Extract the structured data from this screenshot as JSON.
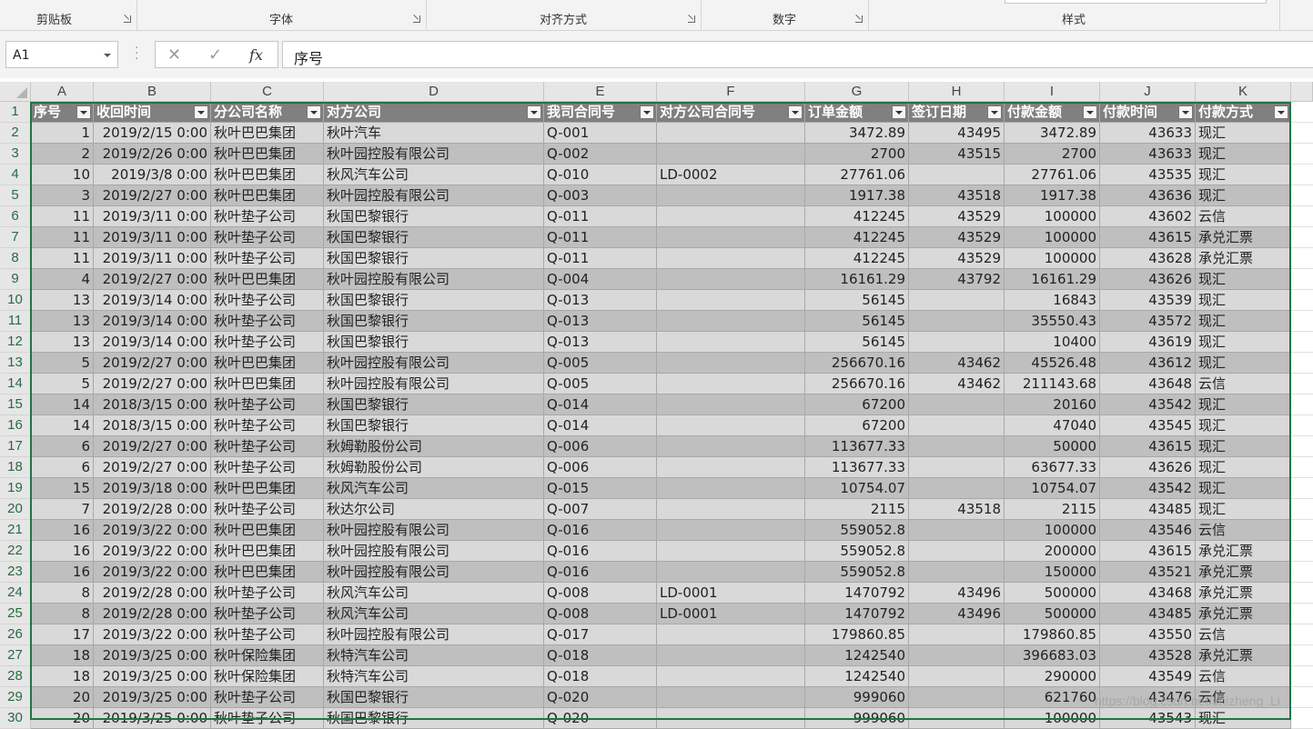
{
  "ribbon": {
    "groups": [
      {
        "label": "剪贴板",
        "launcher": true
      },
      {
        "label": "字体",
        "launcher": true
      },
      {
        "label": "对齐方式",
        "launcher": true
      },
      {
        "label": "数字",
        "launcher": true
      },
      {
        "label": "样式",
        "launcher": false
      }
    ]
  },
  "formula_bar": {
    "name_box": "A1",
    "cancel_icon": "✕",
    "enter_icon": "✓",
    "fx_label": "fx",
    "value": "序号"
  },
  "columns": [
    "A",
    "B",
    "C",
    "D",
    "E",
    "F",
    "G",
    "H",
    "I",
    "J",
    "K"
  ],
  "table": {
    "headers": [
      "序号",
      "收回时间",
      "分公司名称",
      "对方公司",
      "我司合同号",
      "对方公司合同号",
      "订单金额",
      "签订日期",
      "付款金额",
      "付款时间",
      "付款方式"
    ],
    "rows": [
      [
        "1",
        "2019/2/15 0:00",
        "秋叶巴巴集团",
        "秋叶汽车",
        "Q-001",
        "",
        "3472.89",
        "43495",
        "3472.89",
        "43633",
        "现汇"
      ],
      [
        "2",
        "2019/2/26 0:00",
        "秋叶巴巴集团",
        "秋叶园控股有限公司",
        "Q-002",
        "",
        "2700",
        "43515",
        "2700",
        "43633",
        "现汇"
      ],
      [
        "10",
        "2019/3/8 0:00",
        "秋叶巴巴集团",
        "秋风汽车公司",
        "Q-010",
        "LD-0002",
        "27761.06",
        "",
        "27761.06",
        "43535",
        "现汇"
      ],
      [
        "3",
        "2019/2/27 0:00",
        "秋叶巴巴集团",
        "秋叶园控股有限公司",
        "Q-003",
        "",
        "1917.38",
        "43518",
        "1917.38",
        "43636",
        "现汇"
      ],
      [
        "11",
        "2019/3/11 0:00",
        "秋叶垫子公司",
        "秋国巴黎银行",
        "Q-011",
        "",
        "412245",
        "43529",
        "100000",
        "43602",
        "云信"
      ],
      [
        "11",
        "2019/3/11 0:00",
        "秋叶垫子公司",
        "秋国巴黎银行",
        "Q-011",
        "",
        "412245",
        "43529",
        "100000",
        "43615",
        "承兑汇票"
      ],
      [
        "11",
        "2019/3/11 0:00",
        "秋叶垫子公司",
        "秋国巴黎银行",
        "Q-011",
        "",
        "412245",
        "43529",
        "100000",
        "43628",
        "承兑汇票"
      ],
      [
        "4",
        "2019/2/27 0:00",
        "秋叶巴巴集团",
        "秋叶园控股有限公司",
        "Q-004",
        "",
        "16161.29",
        "43792",
        "16161.29",
        "43626",
        "现汇"
      ],
      [
        "13",
        "2019/3/14 0:00",
        "秋叶垫子公司",
        "秋国巴黎银行",
        "Q-013",
        "",
        "56145",
        "",
        "16843",
        "43539",
        "现汇"
      ],
      [
        "13",
        "2019/3/14 0:00",
        "秋叶垫子公司",
        "秋国巴黎银行",
        "Q-013",
        "",
        "56145",
        "",
        "35550.43",
        "43572",
        "现汇"
      ],
      [
        "13",
        "2019/3/14 0:00",
        "秋叶垫子公司",
        "秋国巴黎银行",
        "Q-013",
        "",
        "56145",
        "",
        "10400",
        "43619",
        "现汇"
      ],
      [
        "5",
        "2019/2/27 0:00",
        "秋叶巴巴集团",
        "秋叶园控股有限公司",
        "Q-005",
        "",
        "256670.16",
        "43462",
        "45526.48",
        "43612",
        "现汇"
      ],
      [
        "5",
        "2019/2/27 0:00",
        "秋叶巴巴集团",
        "秋叶园控股有限公司",
        "Q-005",
        "",
        "256670.16",
        "43462",
        "211143.68",
        "43648",
        "云信"
      ],
      [
        "14",
        "2018/3/15 0:00",
        "秋叶垫子公司",
        "秋国巴黎银行",
        "Q-014",
        "",
        "67200",
        "",
        "20160",
        "43542",
        "现汇"
      ],
      [
        "14",
        "2018/3/15 0:00",
        "秋叶垫子公司",
        "秋国巴黎银行",
        "Q-014",
        "",
        "67200",
        "",
        "47040",
        "43545",
        "现汇"
      ],
      [
        "6",
        "2019/2/27 0:00",
        "秋叶垫子公司",
        "秋姆勒股份公司",
        "Q-006",
        "",
        "113677.33",
        "",
        "50000",
        "43615",
        "现汇"
      ],
      [
        "6",
        "2019/2/27 0:00",
        "秋叶垫子公司",
        "秋姆勒股份公司",
        "Q-006",
        "",
        "113677.33",
        "",
        "63677.33",
        "43626",
        "现汇"
      ],
      [
        "15",
        "2019/3/18 0:00",
        "秋叶巴巴集团",
        "秋风汽车公司",
        "Q-015",
        "",
        "10754.07",
        "",
        "10754.07",
        "43542",
        "现汇"
      ],
      [
        "7",
        "2019/2/28 0:00",
        "秋叶垫子公司",
        "秋达尔公司",
        "Q-007",
        "",
        "2115",
        "43518",
        "2115",
        "43485",
        "现汇"
      ],
      [
        "16",
        "2019/3/22 0:00",
        "秋叶巴巴集团",
        "秋叶园控股有限公司",
        "Q-016",
        "",
        "559052.8",
        "",
        "100000",
        "43546",
        "云信"
      ],
      [
        "16",
        "2019/3/22 0:00",
        "秋叶巴巴集团",
        "秋叶园控股有限公司",
        "Q-016",
        "",
        "559052.8",
        "",
        "200000",
        "43615",
        "承兑汇票"
      ],
      [
        "16",
        "2019/3/22 0:00",
        "秋叶巴巴集团",
        "秋叶园控股有限公司",
        "Q-016",
        "",
        "559052.8",
        "",
        "150000",
        "43521",
        "承兑汇票"
      ],
      [
        "8",
        "2019/2/28 0:00",
        "秋叶垫子公司",
        "秋风汽车公司",
        "Q-008",
        "LD-0001",
        "1470792",
        "43496",
        "500000",
        "43468",
        "承兑汇票"
      ],
      [
        "8",
        "2019/2/28 0:00",
        "秋叶垫子公司",
        "秋风汽车公司",
        "Q-008",
        "LD-0001",
        "1470792",
        "43496",
        "500000",
        "43485",
        "承兑汇票"
      ],
      [
        "17",
        "2019/3/22 0:00",
        "秋叶垫子公司",
        "秋叶园控股有限公司",
        "Q-017",
        "",
        "179860.85",
        "",
        "179860.85",
        "43550",
        "云信"
      ],
      [
        "18",
        "2019/3/25 0:00",
        "秋叶保险集团",
        "秋特汽车公司",
        "Q-018",
        "",
        "1242540",
        "",
        "396683.03",
        "43528",
        "承兑汇票"
      ],
      [
        "18",
        "2019/3/25 0:00",
        "秋叶保险集团",
        "秋特汽车公司",
        "Q-018",
        "",
        "1242540",
        "",
        "290000",
        "43549",
        "云信"
      ],
      [
        "20",
        "2019/3/25 0:00",
        "秋叶垫子公司",
        "秋国巴黎银行",
        "Q-020",
        "",
        "999060",
        "",
        "621760",
        "43476",
        "云信"
      ],
      [
        "20",
        "2019/3/25 0:00",
        "秋叶垫子公司",
        "秋国巴黎银行",
        "Q-020",
        "",
        "999060",
        "",
        "100000",
        "43543",
        "现汇"
      ]
    ]
  },
  "watermark": "https://blog.csdn.net/shizheng_Li"
}
